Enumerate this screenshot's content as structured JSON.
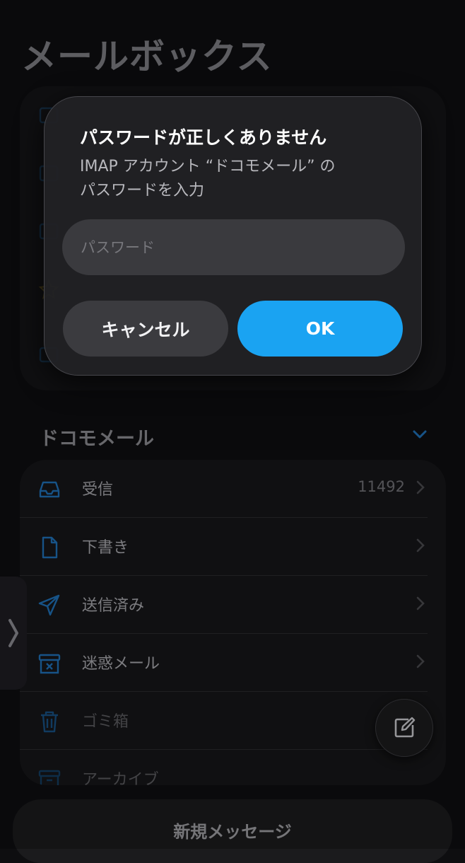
{
  "page": {
    "title": "メールボックス"
  },
  "account": {
    "name": "ドコモメール"
  },
  "folders": [
    {
      "label": "受信",
      "count": "11492",
      "icon": "inbox-tray-icon"
    },
    {
      "label": "下書き",
      "count": "",
      "icon": "document-icon"
    },
    {
      "label": "送信済み",
      "count": "",
      "icon": "paper-plane-icon"
    },
    {
      "label": "迷惑メール",
      "count": "",
      "icon": "junk-box-icon"
    },
    {
      "label": "ゴミ箱",
      "count": "",
      "icon": "trash-icon"
    },
    {
      "label": "アーカイブ",
      "count": "",
      "icon": "archive-box-icon"
    }
  ],
  "bottom_bar": {
    "label": "新規メッセージ"
  },
  "dialog": {
    "title": "パスワードが正しくありません",
    "message": "IMAP アカウント “ドコモメール” の\nパスワードを入力",
    "password_placeholder": "パスワード",
    "password_value": "",
    "cancel_label": "キャンセル",
    "ok_label": "OK"
  },
  "colors": {
    "accent": "#1AA3F2",
    "background": "#0E0E10",
    "icon_blue": "#1F6FB5"
  }
}
